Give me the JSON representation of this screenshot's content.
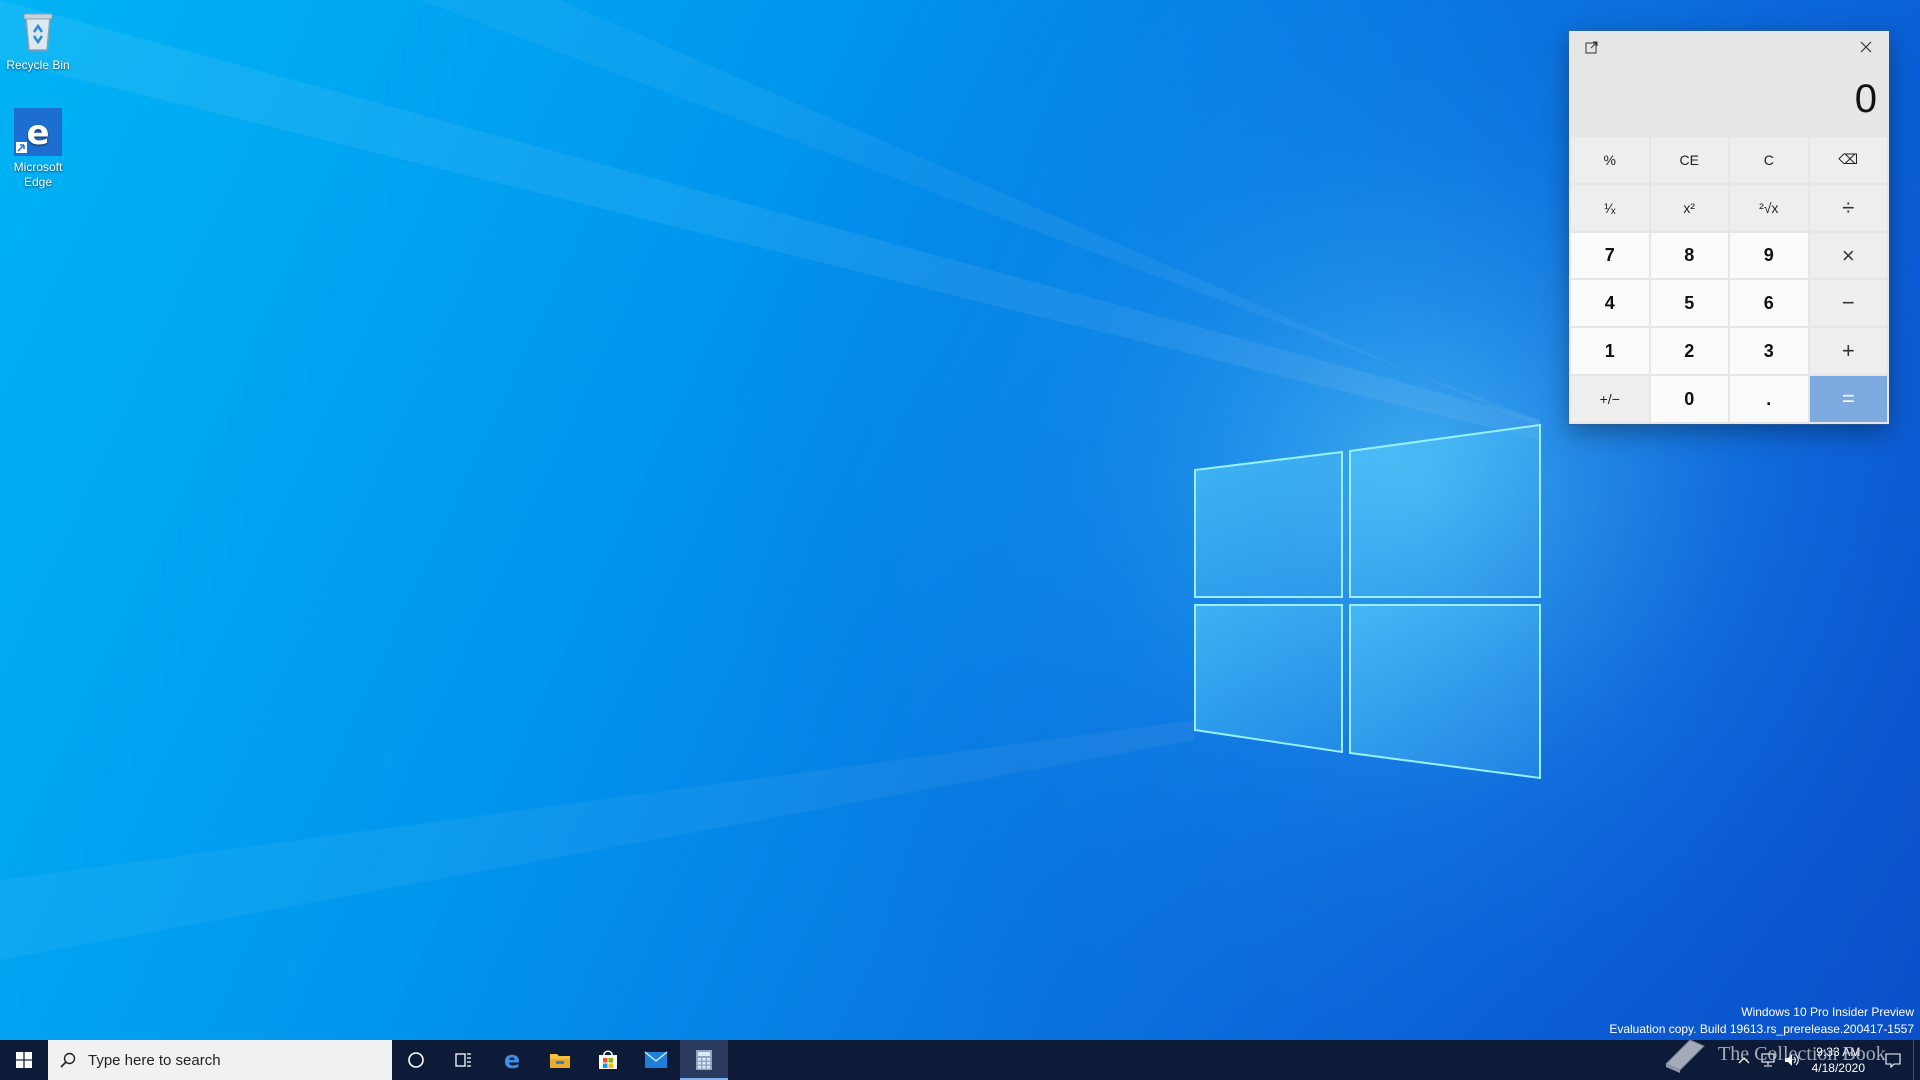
{
  "desktop": {
    "icons": [
      {
        "label": "Recycle Bin",
        "icon": "recycle-bin-icon"
      },
      {
        "label": "Microsoft Edge",
        "icon": "edge-icon"
      }
    ]
  },
  "calculator": {
    "display_value": "0",
    "keys": [
      {
        "label": "%",
        "kind": "fn",
        "name": "percent-button"
      },
      {
        "label": "CE",
        "kind": "fn",
        "name": "clear-entry-button"
      },
      {
        "label": "C",
        "kind": "fn",
        "name": "clear-button"
      },
      {
        "label": "⌫",
        "kind": "fn",
        "name": "backspace-button"
      },
      {
        "label": "¹⁄ₓ",
        "kind": "fn",
        "name": "reciprocal-button"
      },
      {
        "label": "x²",
        "kind": "fn",
        "name": "square-button"
      },
      {
        "label": "²√x",
        "kind": "fn",
        "name": "square-root-button"
      },
      {
        "label": "÷",
        "kind": "op",
        "name": "divide-button"
      },
      {
        "label": "7",
        "kind": "num",
        "name": "digit-7-button"
      },
      {
        "label": "8",
        "kind": "num",
        "name": "digit-8-button"
      },
      {
        "label": "9",
        "kind": "num",
        "name": "digit-9-button"
      },
      {
        "label": "×",
        "kind": "op",
        "name": "multiply-button"
      },
      {
        "label": "4",
        "kind": "num",
        "name": "digit-4-button"
      },
      {
        "label": "5",
        "kind": "num",
        "name": "digit-5-button"
      },
      {
        "label": "6",
        "kind": "num",
        "name": "digit-6-button"
      },
      {
        "label": "−",
        "kind": "op",
        "name": "minus-button"
      },
      {
        "label": "1",
        "kind": "num",
        "name": "digit-1-button"
      },
      {
        "label": "2",
        "kind": "num",
        "name": "digit-2-button"
      },
      {
        "label": "3",
        "kind": "num",
        "name": "digit-3-button"
      },
      {
        "label": "+",
        "kind": "op",
        "name": "plus-button"
      },
      {
        "label": "+/−",
        "kind": "fn",
        "name": "negate-button"
      },
      {
        "label": "0",
        "kind": "num",
        "name": "digit-0-button"
      },
      {
        "label": ".",
        "kind": "num",
        "name": "decimal-button"
      },
      {
        "label": "=",
        "kind": "eq",
        "name": "equals-button"
      }
    ]
  },
  "watermark": {
    "line1": "Windows 10 Pro Insider Preview",
    "line2": "Evaluation copy. Build 19613.rs_prerelease.200417-1557"
  },
  "taskbar": {
    "search_placeholder": "Type here to search",
    "clock_time": "9:33 AM",
    "clock_date": "4/18/2020",
    "pinned": [
      "start-icon",
      "cortana-icon",
      "task-view-icon",
      "edge-icon",
      "file-explorer-icon",
      "store-icon",
      "mail-icon",
      "calculator-icon"
    ]
  },
  "overlay_logo": {
    "text": "The Collection Book"
  }
}
